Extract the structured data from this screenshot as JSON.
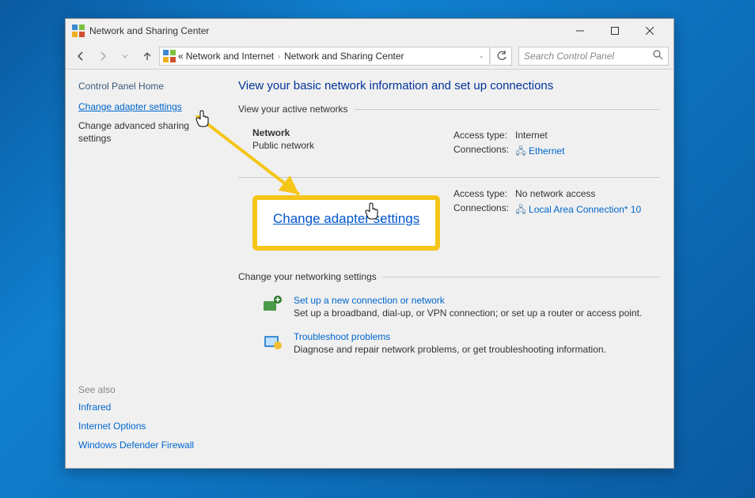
{
  "window_title": "Network and Sharing Center",
  "breadcrumb": {
    "prefix": "«",
    "part1": "Network and Internet",
    "part2": "Network and Sharing Center"
  },
  "search_placeholder": "Search Control Panel",
  "sidebar": {
    "home": "Control Panel Home",
    "change_adapter": "Change adapter settings",
    "change_advanced": "Change advanced sharing settings",
    "see_also_hdr": "See also",
    "see_also": [
      "Infrared",
      "Internet Options",
      "Windows Defender Firewall"
    ]
  },
  "main": {
    "heading": "View your basic network information and set up connections",
    "active_hdr": "View your active networks",
    "networks": [
      {
        "name": "Network",
        "subtitle": "Public network",
        "access_label": "Access type:",
        "access_value": "Internet",
        "conn_label": "Connections:",
        "conn_value": "Ethernet"
      },
      {
        "name": "",
        "subtitle": "",
        "access_label": "Access type:",
        "access_value": "No network access",
        "conn_label": "Connections:",
        "conn_value": "Local Area Connection* 10"
      }
    ],
    "highlight_label": "Change adapter settings",
    "settings_hdr": "Change your networking settings",
    "settings": [
      {
        "title": "Set up a new connection or network",
        "desc": "Set up a broadband, dial-up, or VPN connection; or set up a router or access point."
      },
      {
        "title": "Troubleshoot problems",
        "desc": "Diagnose and repair network problems, or get troubleshooting information."
      }
    ]
  }
}
